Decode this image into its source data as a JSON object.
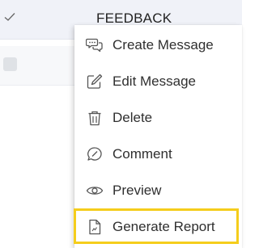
{
  "header": {
    "column_title": "FEEDBACK"
  },
  "menu": {
    "items": [
      {
        "label": "Create Message",
        "icon": "chat-bubbles-icon"
      },
      {
        "label": "Edit Message",
        "icon": "edit-pencil-icon"
      },
      {
        "label": "Delete",
        "icon": "trash-icon"
      },
      {
        "label": "Comment",
        "icon": "comment-icon"
      },
      {
        "label": "Preview",
        "icon": "eye-icon"
      },
      {
        "label": "Generate Report",
        "icon": "report-file-icon"
      }
    ]
  },
  "colors": {
    "header_bg": "#f0f2f8",
    "highlight_border": "#f5cd1c",
    "text": "#2f2f2f",
    "icon": "#555555"
  }
}
